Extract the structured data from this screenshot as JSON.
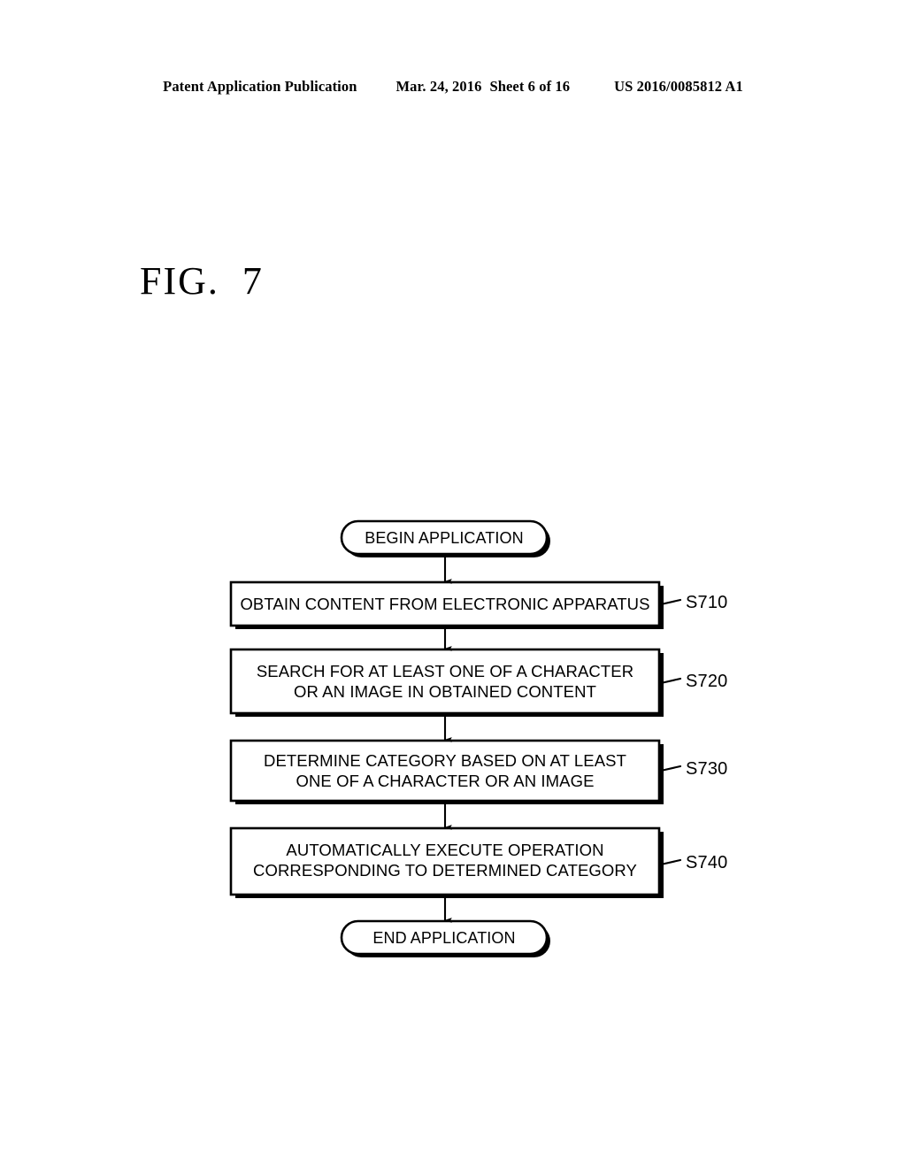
{
  "header": {
    "publication": "Patent Application Publication",
    "date": "Mar. 24, 2016",
    "sheet": "Sheet 6 of 16",
    "patent_number": "US 2016/0085812 A1"
  },
  "figure": {
    "label": "FIG.  7"
  },
  "flowchart": {
    "type": "flowchart",
    "orientation": "top-to-bottom",
    "line_color": "#000000",
    "fill_color": "#ffffff",
    "nodes": [
      {
        "id": "begin",
        "shape": "terminator",
        "text": "BEGIN APPLICATION",
        "ref": ""
      },
      {
        "id": "s710",
        "shape": "process",
        "text": "OBTAIN CONTENT FROM ELECTRONIC APPARATUS",
        "ref": "S710"
      },
      {
        "id": "s720",
        "shape": "process",
        "text": "SEARCH FOR AT LEAST ONE OF A CHARACTER\nOR AN IMAGE IN OBTAINED CONTENT",
        "ref": "S720"
      },
      {
        "id": "s730",
        "shape": "process",
        "text": "DETERMINE CATEGORY BASED ON AT LEAST\nONE OF A CHARACTER OR AN IMAGE",
        "ref": "S730"
      },
      {
        "id": "s740",
        "shape": "process",
        "text": "AUTOMATICALLY EXECUTE OPERATION\nCORRESPONDING TO DETERMINED CATEGORY",
        "ref": "S740"
      },
      {
        "id": "end",
        "shape": "terminator",
        "text": "END APPLICATION",
        "ref": ""
      }
    ],
    "edges": [
      {
        "from": "begin",
        "to": "s710",
        "arrow": true
      },
      {
        "from": "s710",
        "to": "s720",
        "arrow": true
      },
      {
        "from": "s720",
        "to": "s730",
        "arrow": true
      },
      {
        "from": "s730",
        "to": "s740",
        "arrow": true
      },
      {
        "from": "s740",
        "to": "end",
        "arrow": true
      }
    ]
  }
}
